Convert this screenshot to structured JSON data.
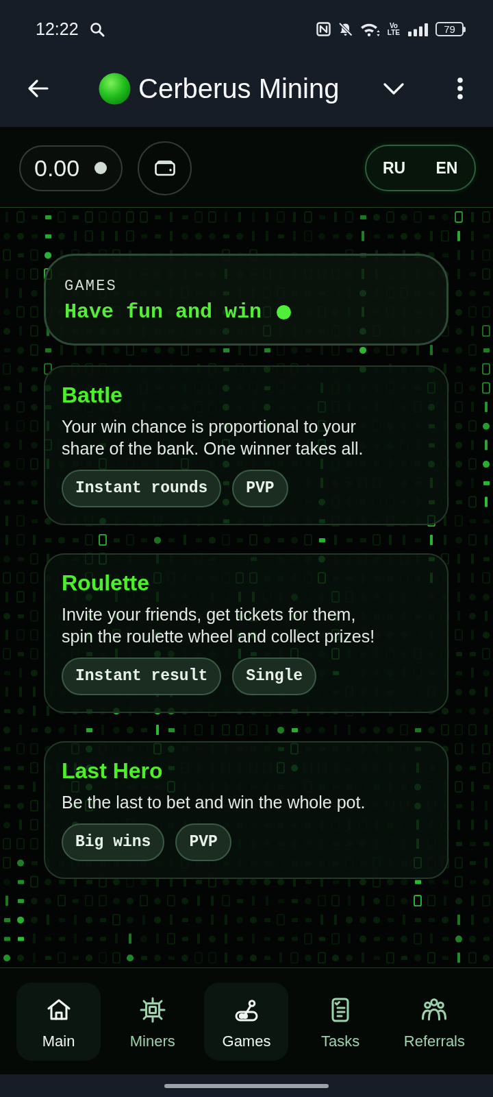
{
  "status_bar": {
    "time": "12:22",
    "network_type": [
      "Vo",
      "LTE"
    ],
    "battery": "79"
  },
  "app_bar": {
    "title": "Cerberus Mining"
  },
  "header": {
    "balance": "0.00",
    "languages": [
      {
        "label": "RU",
        "selected": false
      },
      {
        "label": "EN",
        "selected": false
      }
    ]
  },
  "intro": {
    "eyebrow": "GAMES",
    "heading": "Have fun and win"
  },
  "games": [
    {
      "title": "Battle",
      "description": "Your win chance is proportional to your share of the bank. One winner takes all.",
      "tags": [
        "Instant rounds",
        "PVP"
      ]
    },
    {
      "title": "Roulette",
      "description": "Invite your friends, get tickets for them, spin the roulette wheel and collect prizes!",
      "tags": [
        "Instant result",
        "Single"
      ]
    },
    {
      "title": "Last Hero",
      "description": "Be the last to bet and win the whole pot.",
      "tags": [
        "Big wins",
        "PVP"
      ]
    }
  ],
  "bottom_nav": [
    {
      "label": "Main",
      "selected": true
    },
    {
      "label": "Miners",
      "selected": false
    },
    {
      "label": "Games",
      "selected": true
    },
    {
      "label": "Tasks",
      "selected": false
    },
    {
      "label": "Referrals",
      "selected": false
    }
  ]
}
